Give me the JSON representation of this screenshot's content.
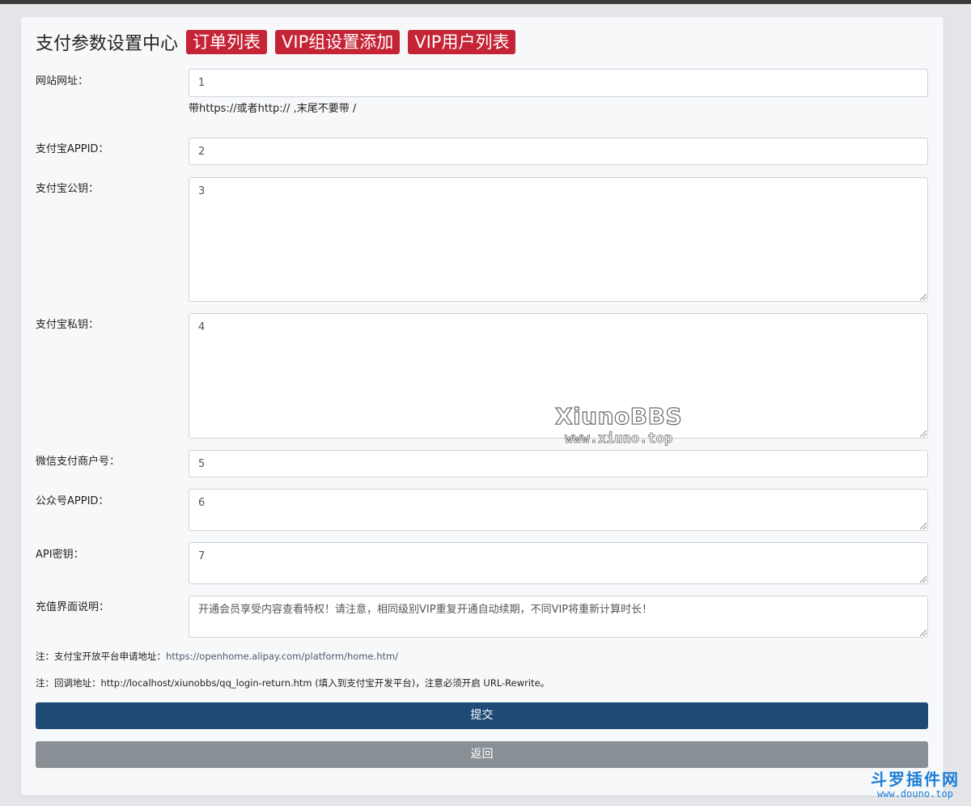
{
  "header": {
    "title": "支付参数设置中心",
    "buttons": [
      "订单列表",
      "VIP组设置添加",
      "VIP用户列表"
    ]
  },
  "form": {
    "site_url": {
      "label": "网站网址：",
      "value": "1",
      "hint": "带https://或者http:// ,末尾不要带 /"
    },
    "alipay_appid": {
      "label": "支付宝APPID：",
      "value": "2"
    },
    "alipay_public_key": {
      "label": "支付宝公钥：",
      "value": "3"
    },
    "alipay_private_key": {
      "label": "支付宝私钥：",
      "value": "4"
    },
    "wechat_mch_id": {
      "label": "微信支付商户号：",
      "value": "5"
    },
    "mp_appid": {
      "label": "公众号APPID：",
      "value": "6"
    },
    "api_key": {
      "label": "API密钥：",
      "value": "7"
    },
    "recharge_desc": {
      "label": "充值界面说明：",
      "value": "开通会员享受内容查看特权！请注意，相同级别VIP重复开通自动续期，不同VIP将重新计算时长！"
    }
  },
  "notes": {
    "note1_prefix": "注：支付宝开放平台申请地址：",
    "note1_link": "https://openhome.alipay.com/platform/home.htm/",
    "note2": "注：回调地址：http://localhost/xiunobbs/qq_login-return.htm (填入到支付宝开发平台)，注意必须开启 URL-Rewrite。"
  },
  "actions": {
    "submit": "提交",
    "back": "返回"
  },
  "watermark": {
    "brand": "XiunoBBS",
    "url": "www.xiuno.top"
  },
  "corner_logo": {
    "brand": "斗罗插件网",
    "url": "www.douno.top"
  }
}
